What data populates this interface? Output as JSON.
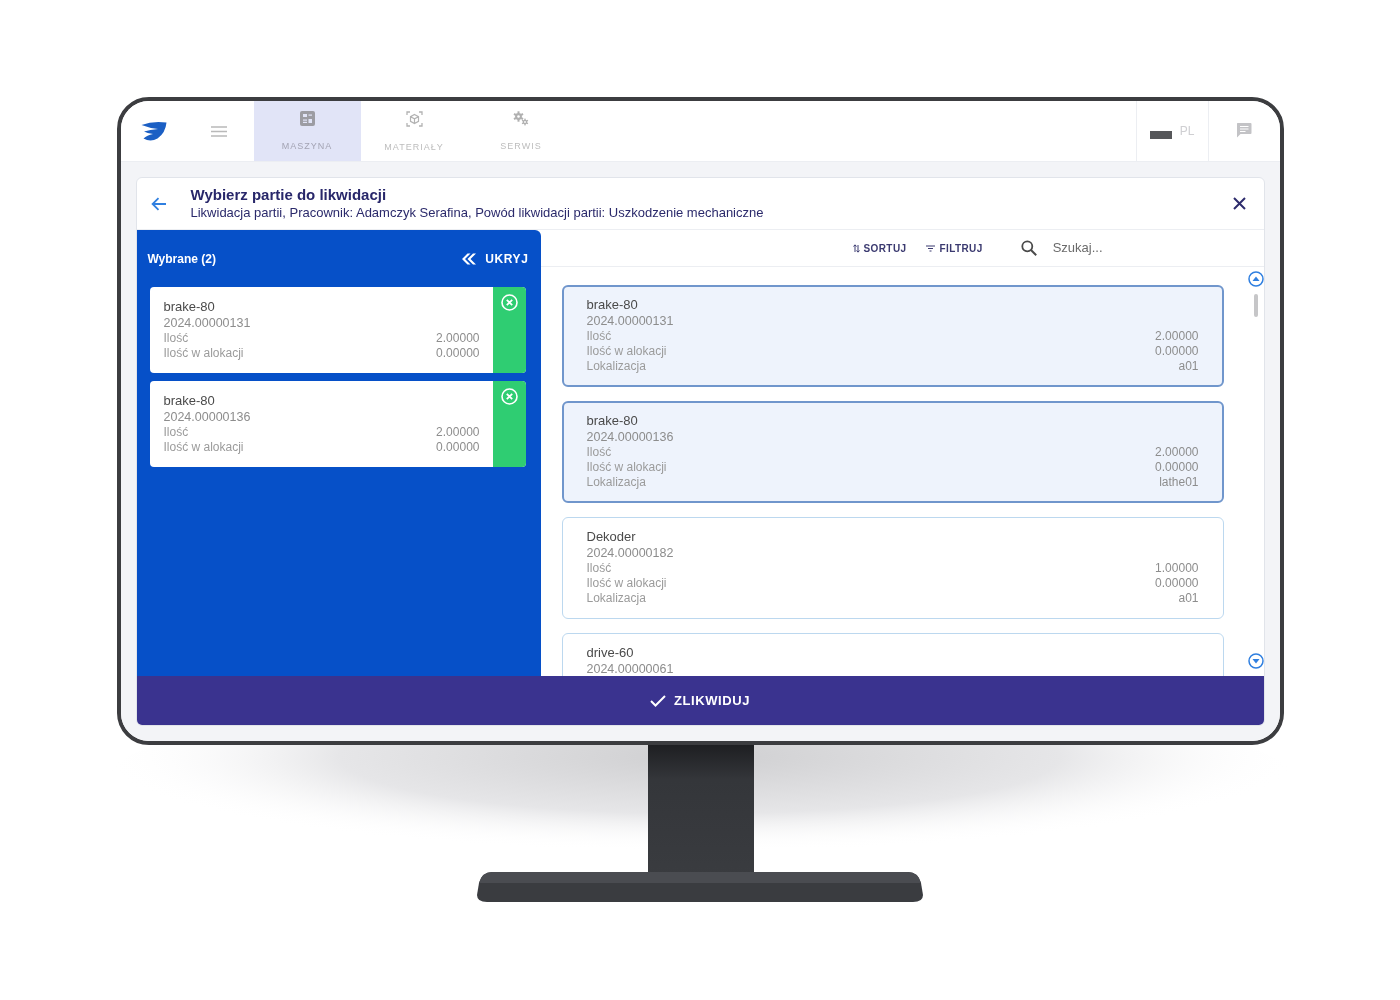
{
  "app_bar": {
    "tabs": [
      {
        "label": "MASZYNA",
        "selected": true
      },
      {
        "label": "MATERIAŁY",
        "selected": false
      },
      {
        "label": "SERWIS",
        "selected": false
      }
    ],
    "language": "PL"
  },
  "dialog": {
    "title": "Wybierz partie do likwidacji",
    "subtitle": "Likwidacja partii, Pracownik: Adamczyk Serafina, Powód likwidacji partii: Uszkodzenie mechaniczne"
  },
  "selected_panel": {
    "title": "Wybrane (2)",
    "hide_button": "UKRYJ",
    "items": [
      {
        "name": "brake-80",
        "batch": "2024.00000131",
        "fields": [
          {
            "label": "Ilość",
            "value": "2.00000"
          },
          {
            "label": "Ilość w alokacji",
            "value": "0.00000"
          }
        ]
      },
      {
        "name": "brake-80",
        "batch": "2024.00000136",
        "fields": [
          {
            "label": "Ilość",
            "value": "2.00000"
          },
          {
            "label": "Ilość w alokacji",
            "value": "0.00000"
          }
        ]
      }
    ]
  },
  "toolbar": {
    "sort": "SORTUJ",
    "filter": "FILTRUJ",
    "search": {
      "placeholder": "Szukaj..."
    }
  },
  "batches": [
    {
      "name": "brake-80",
      "batch": "2024.00000131",
      "selected": true,
      "fields": [
        {
          "label": "Ilość",
          "value": "2.00000"
        },
        {
          "label": "Ilość w alokacji",
          "value": "0.00000"
        },
        {
          "label": "Lokalizacja",
          "value": "a01"
        }
      ]
    },
    {
      "name": "brake-80",
      "batch": "2024.00000136",
      "selected": true,
      "fields": [
        {
          "label": "Ilość",
          "value": "2.00000"
        },
        {
          "label": "Ilość w alokacji",
          "value": "0.00000"
        },
        {
          "label": "Lokalizacja",
          "value": "lathe01"
        }
      ]
    },
    {
      "name": "Dekoder",
      "batch": "2024.00000182",
      "selected": false,
      "fields": [
        {
          "label": "Ilość",
          "value": "1.00000"
        },
        {
          "label": "Ilość w alokacji",
          "value": "0.00000"
        },
        {
          "label": "Lokalizacja",
          "value": "a01"
        }
      ]
    },
    {
      "name": "drive-60",
      "batch": "2024.00000061",
      "selected": false
    }
  ],
  "confirm_button": "ZLIKWIDUJ"
}
